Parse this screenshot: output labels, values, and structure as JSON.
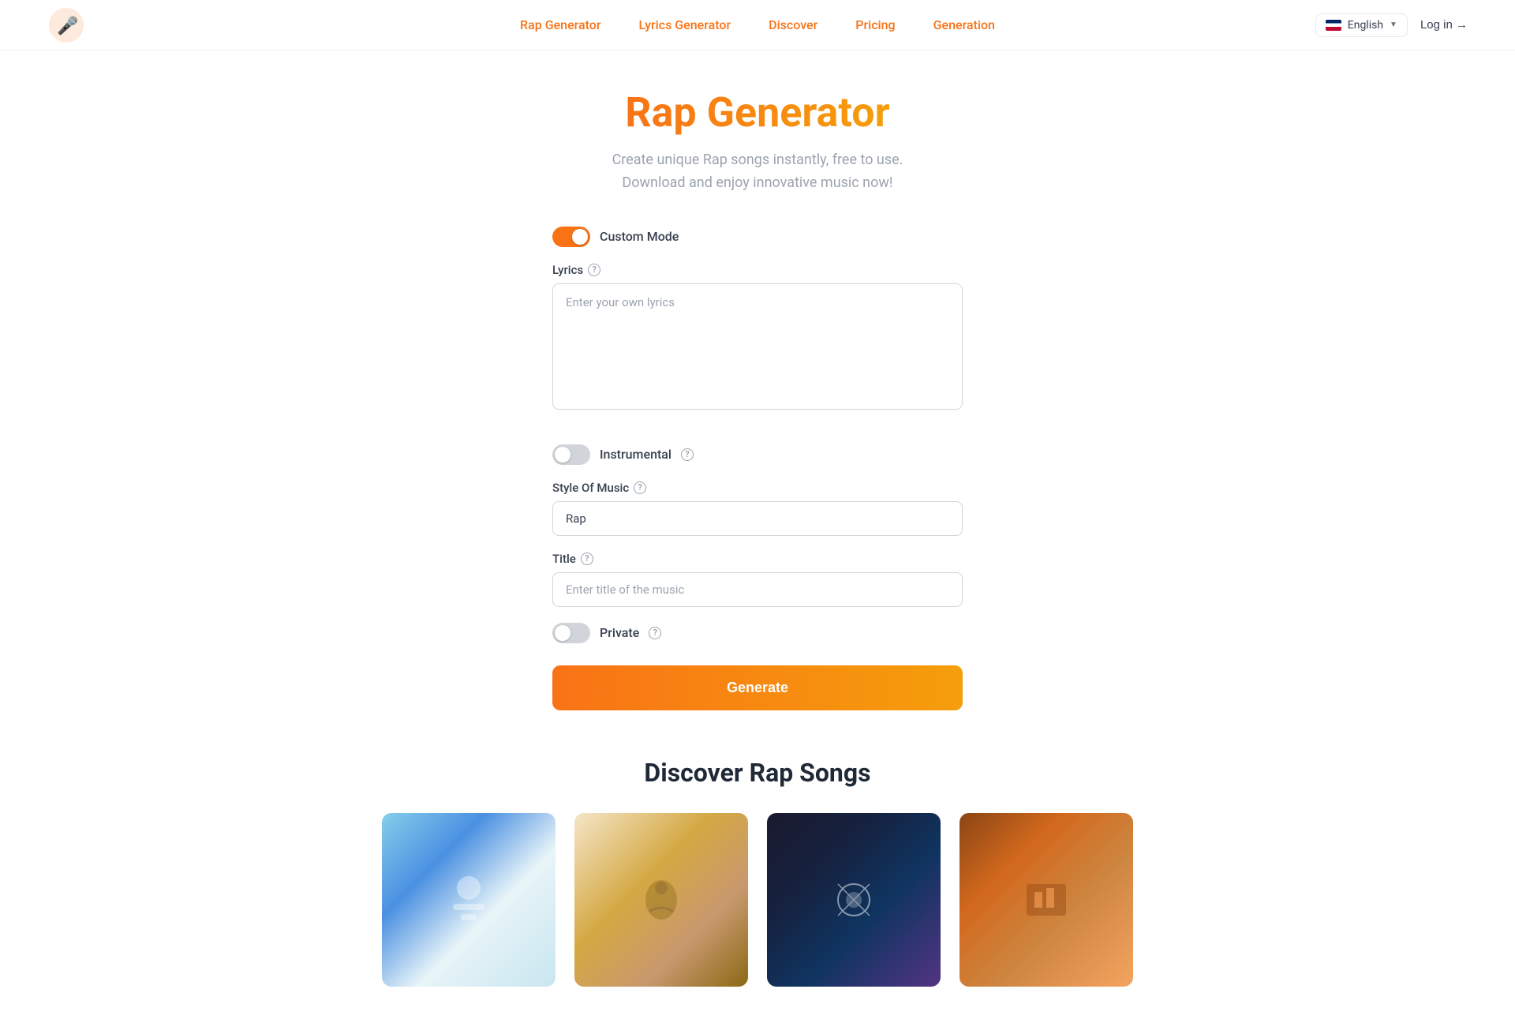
{
  "navbar": {
    "logo_alt": "Rap Generator Logo",
    "links": [
      {
        "id": "rap-generator",
        "label": "Rap Generator"
      },
      {
        "id": "lyrics-generator",
        "label": "Lyrics Generator"
      },
      {
        "id": "discover",
        "label": "Discover"
      },
      {
        "id": "pricing",
        "label": "Pricing"
      },
      {
        "id": "generation",
        "label": "Generation"
      }
    ],
    "language": "English",
    "login_label": "Log in →"
  },
  "page": {
    "title": "Rap Generator",
    "subtitle_line1": "Create unique Rap songs instantly, free to use.",
    "subtitle_line2": "Download and enjoy innovative music now!"
  },
  "form": {
    "custom_mode_label": "Custom Mode",
    "custom_mode_on": true,
    "lyrics_label": "Lyrics",
    "lyrics_placeholder": "Enter your own lyrics",
    "instrumental_label": "Instrumental",
    "instrumental_on": false,
    "style_label": "Style Of Music",
    "style_value": "Rap",
    "title_label": "Title",
    "title_placeholder": "Enter title of the music",
    "private_label": "Private",
    "private_on": false,
    "generate_label": "Generate"
  },
  "discover": {
    "title": "Discover Rap Songs",
    "songs": [
      {
        "id": 1,
        "art_class": "card-art-1"
      },
      {
        "id": 2,
        "art_class": "card-art-2"
      },
      {
        "id": 3,
        "art_class": "card-art-3"
      },
      {
        "id": 4,
        "art_class": "card-art-4"
      }
    ]
  }
}
